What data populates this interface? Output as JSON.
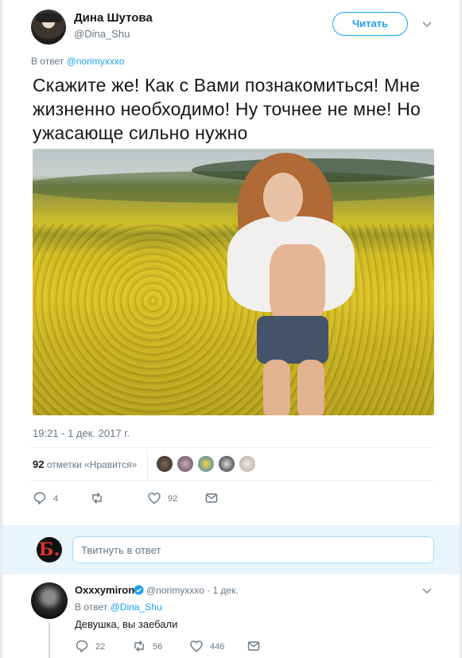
{
  "author": {
    "name": "Дина Шутова",
    "handle": "@Dina_Shu",
    "follow_label": "Читать"
  },
  "tweet": {
    "reply_prefix": "В ответ",
    "reply_to": "@norimyxxxo",
    "text": "Скажите же! Как с Вами познакомиться! Мне жизненно необходимо! Ну точнее не мне! Но ужасающе сильно нужно",
    "timestamp": "19:21 - 1 дек. 2017 г.",
    "likes_count": "92",
    "likes_label": "отметки «Нравится»",
    "actions": {
      "reply_count": "4",
      "retweet_count": "",
      "like_count": "92"
    }
  },
  "compose": {
    "avatar_glyph": "Б.",
    "placeholder": "Твитнуть в ответ"
  },
  "reply": {
    "name": "Oxxxymiron",
    "handle_time": "@norimyxxxo · 1 дек.",
    "reply_prefix": "В ответ",
    "reply_to": "@Dina_Shu",
    "text": "Девушка, вы заебали",
    "reply_count": "22",
    "retweet_count": "56",
    "like_count": "446"
  },
  "colors": {
    "accent": "#1da1f2",
    "muted": "#657786",
    "text": "#14171a",
    "background": "#e6ecf0"
  },
  "icons": [
    "chevron-down-icon",
    "reply-icon",
    "retweet-icon",
    "heart-icon",
    "envelope-icon",
    "verified-badge-icon"
  ]
}
